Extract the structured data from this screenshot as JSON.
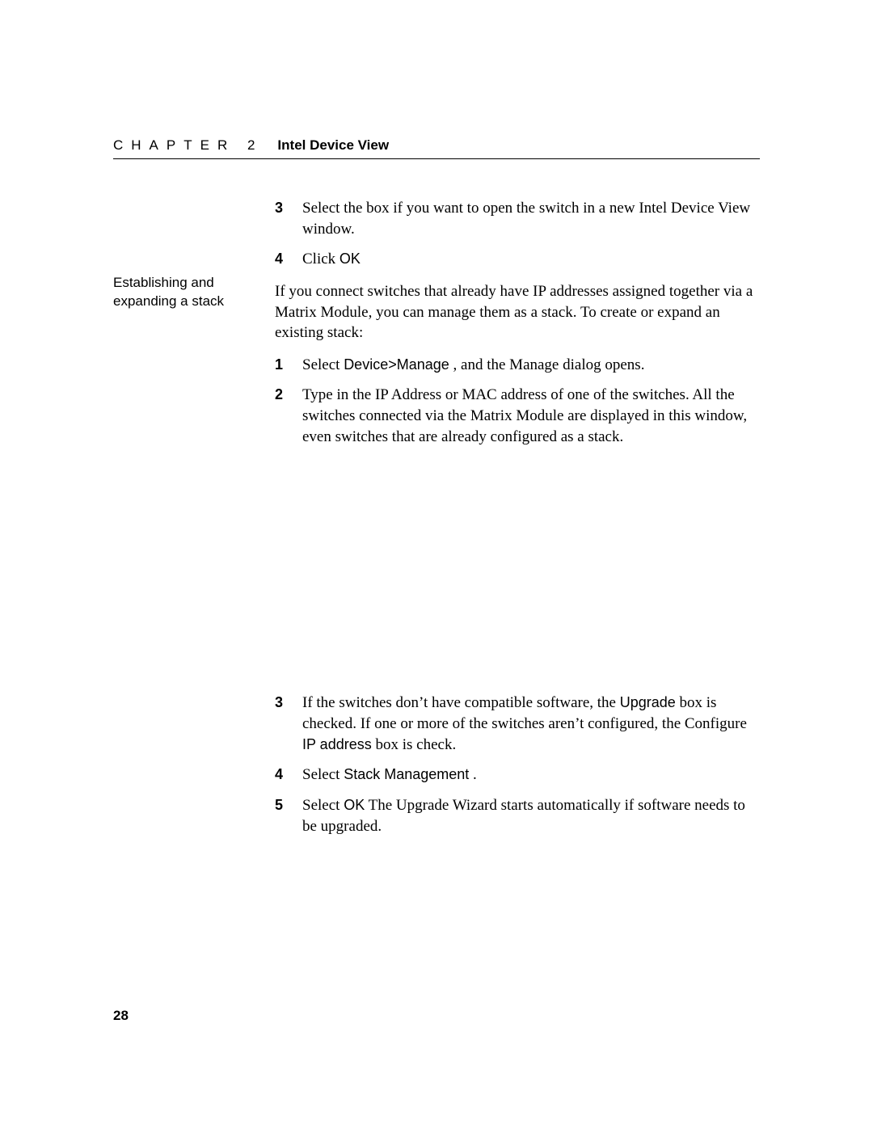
{
  "header": {
    "chapter_word": "CHAPTER 2",
    "title": "Intel Device View"
  },
  "sidebar": {
    "heading": "Establishing and expanding a stack"
  },
  "top_steps": [
    {
      "n": "3",
      "text": "Select the box if you want to open the switch in a new Intel Device View window."
    },
    {
      "n": "4",
      "prefix": "Click ",
      "code": "OK"
    }
  ],
  "intro": "If you connect switches that already have IP addresses assigned together via a Matrix Module, you can manage them as a stack. To create or expand an existing stack:",
  "mid_steps": [
    {
      "n": "1",
      "prefix": "Select ",
      "code": "Device>Manage",
      "suffix": " , and the Manage dialog opens."
    },
    {
      "n": "2",
      "text": "Type in the IP Address or MAC address of one of the switches. All the switches connected via the Matrix Module are displayed in this window, even switches that are already configured as a stack."
    }
  ],
  "bottom_steps": {
    "s3": {
      "n": "3",
      "pre": "If the switches don’t have compatible software, the ",
      "code1": "Upgrade",
      "mid": " box is checked. If one or more of the switches aren’t configured, the Configure ",
      "code2": "IP address",
      "post": " box is check."
    },
    "s4": {
      "n": "4",
      "prefix": "Select ",
      "code": "Stack Management",
      "suffix": " ."
    },
    "s5": {
      "n": "5",
      "prefix": "Select ",
      "code": "OK",
      "suffix": " The Upgrade Wizard starts automatically if software needs to be upgraded."
    }
  },
  "page_number": "28"
}
